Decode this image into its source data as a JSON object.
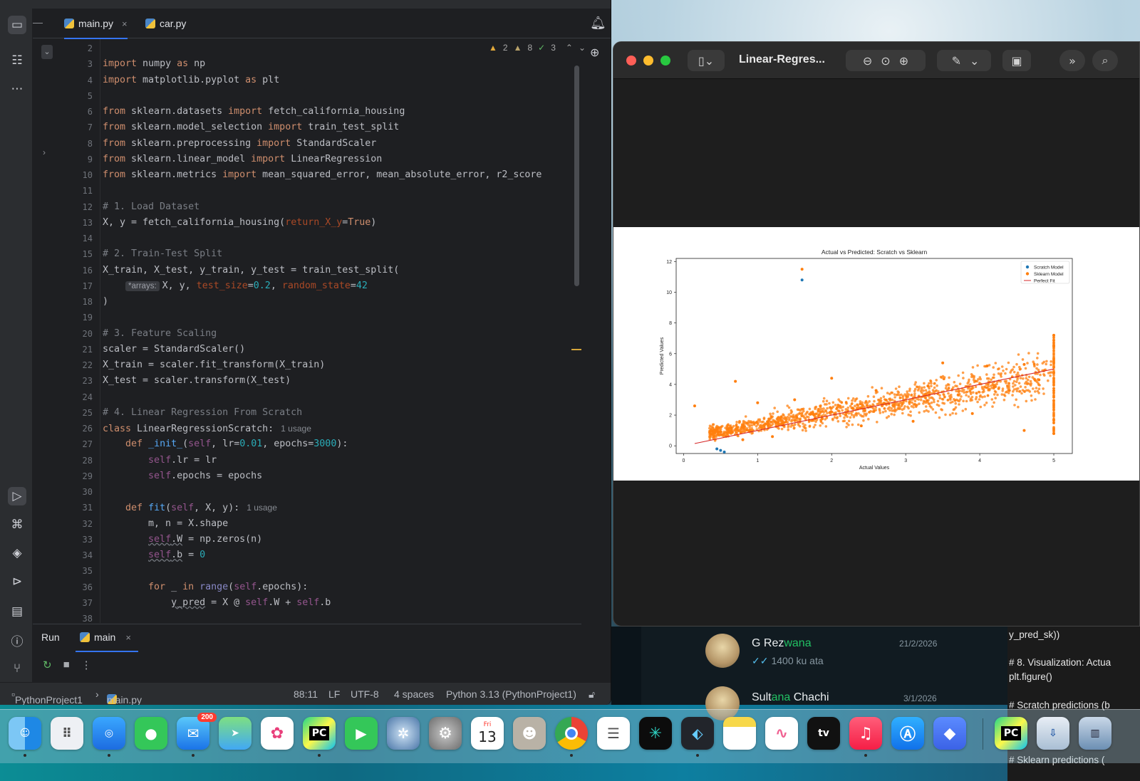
{
  "ide": {
    "tabs": [
      {
        "label": "main.py",
        "close": "×"
      },
      {
        "label": "car.py"
      }
    ],
    "inspections": {
      "warnings": "2",
      "weak_warnings": "8",
      "ok": "3"
    },
    "code_lines": [
      {
        "n": "2",
        "html": ""
      },
      {
        "n": "3",
        "html": "<span class='kw'>import</span> numpy <span class='kw'>as</span> np"
      },
      {
        "n": "4",
        "html": "<span class='kw'>import</span> matplotlib.pyplot <span class='kw'>as</span> plt"
      },
      {
        "n": "5",
        "html": ""
      },
      {
        "n": "6",
        "html": "<span class='kw'>from</span> sklearn.datasets <span class='kw'>import</span> fetch_california_housing"
      },
      {
        "n": "7",
        "html": "<span class='kw'>from</span> sklearn.model_selection <span class='kw'>import</span> train_test_split"
      },
      {
        "n": "8",
        "html": "<span class='kw'>from</span> sklearn.preprocessing <span class='kw'>import</span> StandardScaler"
      },
      {
        "n": "9",
        "html": "<span class='kw'>from</span> sklearn.linear_model <span class='kw'>import</span> LinearRegression"
      },
      {
        "n": "10",
        "html": "<span class='kw'>from</span> sklearn.metrics <span class='kw'>import</span> mean_squared_error, mean_absolute_error, r2_score"
      },
      {
        "n": "11",
        "html": ""
      },
      {
        "n": "12",
        "html": "<span class='cm'># 1. Load Dataset</span>"
      },
      {
        "n": "13",
        "html": "X, y = fetch_california_housing(<span class='pn'>return_X_y</span>=<span class='kw'>True</span>)"
      },
      {
        "n": "14",
        "html": ""
      },
      {
        "n": "15",
        "html": "<span class='cm'># 2. Train-Test Split</span>"
      },
      {
        "n": "16",
        "html": "X_train, X_test, y_train, y_test = train_test_split("
      },
      {
        "n": "17",
        "html": "    <span class='inlay'>*arrays:</span>X, y, <span class='pn'>test_size</span>=<span class='nm'>0.2</span>, <span class='pn'>random_state</span>=<span class='nm'>42</span>"
      },
      {
        "n": "18",
        "html": ")"
      },
      {
        "n": "19",
        "html": ""
      },
      {
        "n": "20",
        "html": "<span class='cm'># 3. Feature Scaling</span>"
      },
      {
        "n": "21",
        "html": "scaler = StandardScaler()"
      },
      {
        "n": "22",
        "html": "X_train = scaler.fit_transform(X_train)"
      },
      {
        "n": "23",
        "html": "X_test = scaler.transform(X_test)"
      },
      {
        "n": "24",
        "html": ""
      },
      {
        "n": "25",
        "html": "<span class='cm'># 4. Linear Regression From Scratch</span>"
      },
      {
        "n": "26",
        "html": "<span class='kw'>class</span> LinearRegressionScratch:<span class='hint'>1 usage</span>"
      },
      {
        "n": "27",
        "html": "    <span class='kw'>def</span> <span class='fn'>_init_</span>(<span class='sf'>self</span>, lr=<span class='nm'>0.01</span>, epochs=<span class='nm'>3000</span>):"
      },
      {
        "n": "28",
        "html": "        <span class='sf'>self</span>.lr = lr"
      },
      {
        "n": "29",
        "html": "        <span class='sf'>self</span>.epochs = epochs"
      },
      {
        "n": "30",
        "html": ""
      },
      {
        "n": "31",
        "html": "    <span class='kw'>def</span> <span class='fn'>fit</span>(<span class='sf'>self</span>, X, y):<span class='hint'>1 usage</span>"
      },
      {
        "n": "32",
        "html": "        m, n = X.shape"
      },
      {
        "n": "33",
        "html": "        <span class='sf squig'>self</span><span class='squig'>.W</span> = np.zeros(n)"
      },
      {
        "n": "34",
        "html": "        <span class='sf squig'>self</span><span class='squig'>.b</span> = <span class='nm'>0</span>"
      },
      {
        "n": "35",
        "html": ""
      },
      {
        "n": "36",
        "html": "        <span class='kw'>for</span> _ <span class='kw'>in</span> <span class='bi'>range</span>(<span class='sf'>self</span>.epochs):"
      },
      {
        "n": "37",
        "html": "            <span class='squig'>y_pred</span> = X @ <span class='sf'>self</span>.W + <span class='sf'>self</span>.b"
      },
      {
        "n": "38",
        "html": ""
      }
    ],
    "run_panel": {
      "title": "Run",
      "tab": "main",
      "close": "×"
    },
    "status_bar": {
      "project": "PythonProject1",
      "file": "main.py",
      "position": "88:11",
      "line_sep": "LF",
      "encoding": "UTF-8",
      "indent": "4 spaces",
      "interpreter": "Python 3.13 (PythonProject1)"
    }
  },
  "preview": {
    "title": "Linear-Regres..."
  },
  "chart_data": {
    "type": "scatter",
    "title": "Actual vs Predicted: Scratch vs Sklearn",
    "xlabel": "Actual Values",
    "ylabel": "Predicted Values",
    "xlim": [
      -0.1,
      5.25
    ],
    "ylim": [
      -0.5,
      12.2
    ],
    "xticks": [
      "0",
      "1",
      "2",
      "3",
      "4",
      "5"
    ],
    "yticks": [
      "0",
      "2",
      "4",
      "6",
      "8",
      "10",
      "12"
    ],
    "legend_position": "top-right",
    "series": [
      {
        "name": "Scratch Model",
        "color": "#1f77b4",
        "points": [
          [
            1.6,
            10.8
          ],
          [
            0.5,
            -0.3
          ],
          [
            0.55,
            -0.4
          ],
          [
            0.45,
            -0.2
          ]
        ]
      },
      {
        "name": "Sklearn Model",
        "color": "#ff7f0e",
        "points": [
          [
            1.6,
            11.5
          ],
          [
            0.15,
            2.6
          ],
          [
            0.7,
            4.2
          ],
          [
            2.0,
            4.4
          ],
          [
            3.5,
            5.4
          ],
          [
            4.1,
            5.2
          ],
          [
            4.6,
            5.3
          ],
          [
            5.0,
            7.2
          ],
          [
            5.0,
            6.5
          ],
          [
            5.0,
            0.8
          ],
          [
            4.6,
            1.0
          ],
          [
            3.9,
            2.1
          ],
          [
            3.1,
            1.6
          ],
          [
            2.4,
            1.3
          ],
          [
            1.2,
            0.6
          ],
          [
            0.8,
            0.4
          ],
          [
            1.0,
            2.8
          ],
          [
            1.5,
            3.0
          ],
          [
            2.6,
            3.6
          ],
          [
            3.3,
            3.9
          ],
          [
            4.4,
            3.6
          ],
          [
            4.8,
            4.3
          ]
        ]
      },
      {
        "name": "Perfect Fit",
        "color": "#d62728",
        "line": [
          [
            0.15,
            0.15
          ],
          [
            5.0,
            5.0
          ]
        ]
      }
    ]
  },
  "chat": {
    "items": [
      {
        "name_prefix": "G Rez",
        "name_hl": "wana",
        "date": "21/2/2026",
        "msg": "1400 ku ata",
        "tick": "✓✓"
      },
      {
        "name_prefix": "Sult",
        "name_hl": "ana",
        "name_suffix": " Chachi",
        "date": "3/1/2026"
      }
    ]
  },
  "notes": {
    "lines": [
      "y_pred_sk))",
      "# 8. Visualization: Actua",
      "plt.figure()",
      "# Scratch predictions (b",
      "# Sklearn predictions ("
    ]
  },
  "dock": {
    "mail_badge": "200",
    "calendar_day": "Fri",
    "calendar_date": "13",
    "pycharm_label": "PC",
    "tv_label": "tv"
  }
}
